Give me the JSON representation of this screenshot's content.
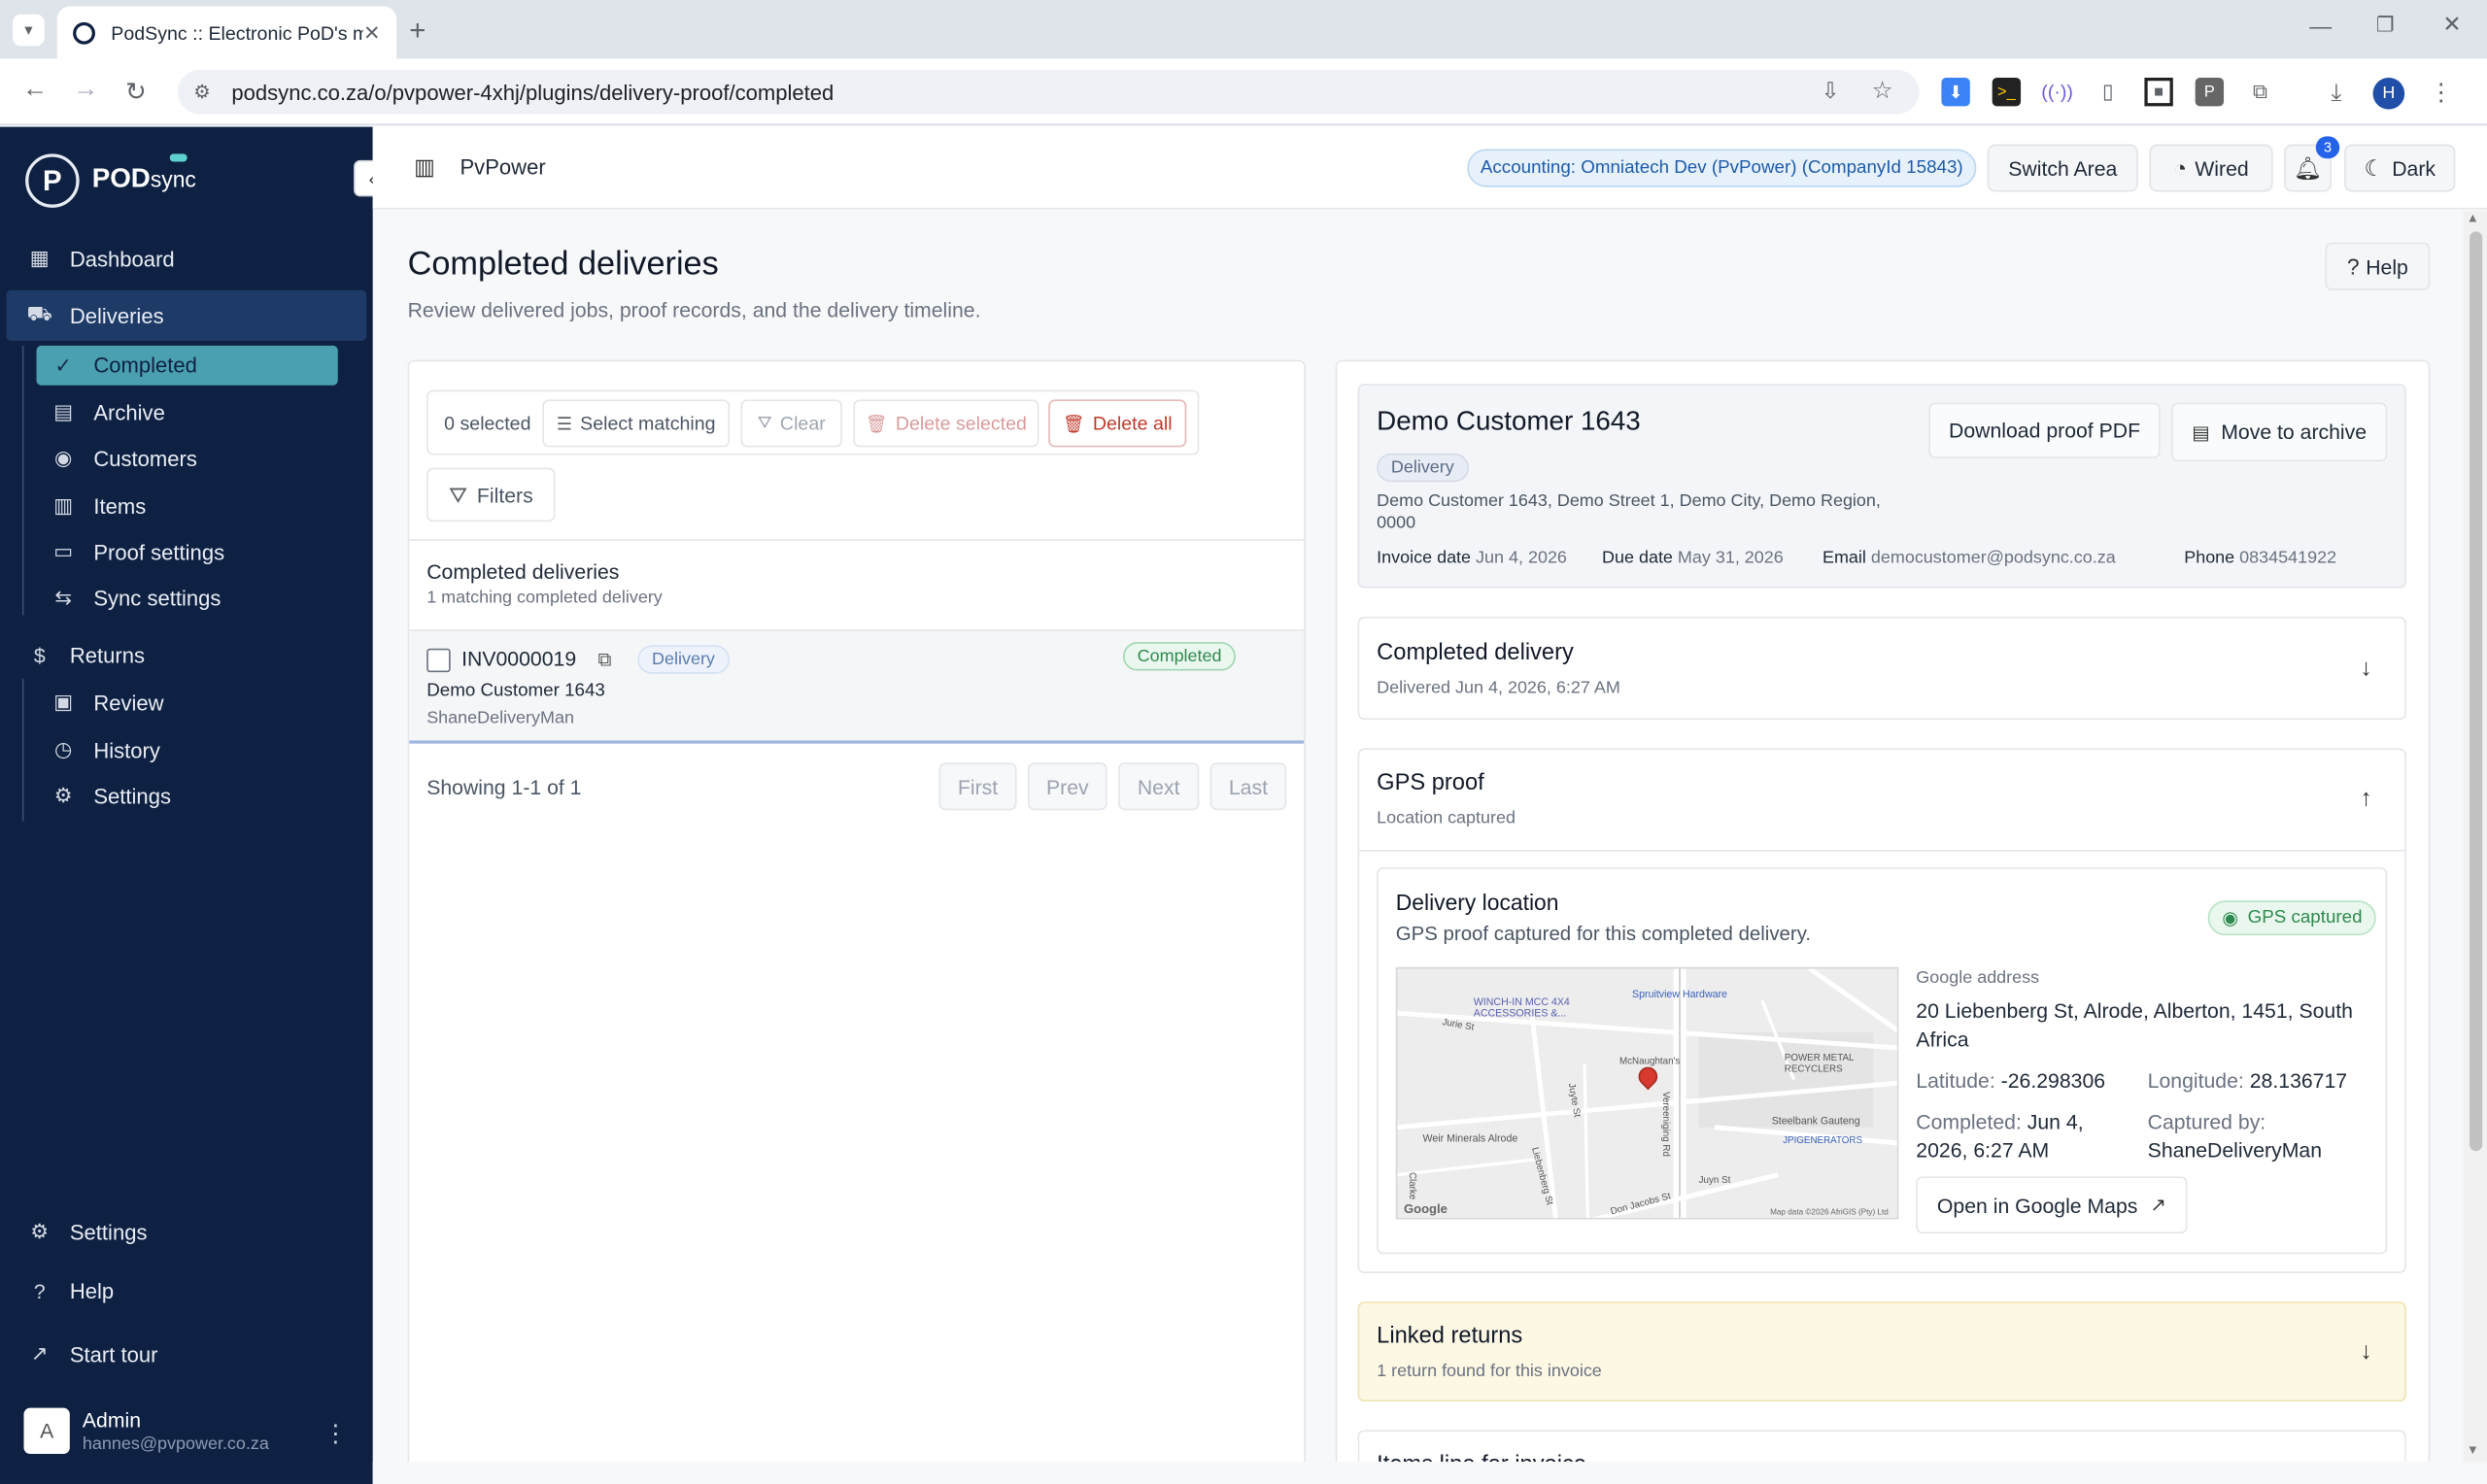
{
  "browser": {
    "tab_title": "PodSync :: Electronic PoD's made",
    "url": "podsync.co.za/o/pvpower-4xhj/plugins/delivery-proof/completed",
    "profile_initial": "H"
  },
  "sidebar": {
    "brand": "POD",
    "brand_suffix": "sync",
    "dashboard": "Dashboard",
    "deliveries": "Deliveries",
    "deliveries_items": [
      "Completed",
      "Archive",
      "Customers",
      "Items",
      "Proof settings",
      "Sync settings"
    ],
    "returns": "Returns",
    "returns_items": [
      "Review",
      "History",
      "Settings"
    ],
    "settings": "Settings",
    "help": "Help",
    "start_tour": "Start tour",
    "user": {
      "initial": "A",
      "name": "Admin",
      "email": "hannes@pvpower.co.za"
    }
  },
  "header": {
    "org": "PvPower",
    "accounting": "Accounting: Omniatech Dev (PvPower) (CompanyId 15843)",
    "switch_area": "Switch Area",
    "wired": "Wired",
    "notifications": "3",
    "dark": "Dark"
  },
  "page": {
    "title": "Completed deliveries",
    "subtitle": "Review delivered jobs, proof records, and the delivery timeline.",
    "help": "Help"
  },
  "list": {
    "selected": "0 selected",
    "select_matching": "Select matching",
    "clear": "Clear",
    "delete_selected": "Delete selected",
    "delete_all": "Delete all",
    "filters": "Filters",
    "heading": "Completed deliveries",
    "count": "1 matching completed delivery",
    "rows": [
      {
        "invoice": "INV0000019",
        "type": "Delivery",
        "status": "Completed",
        "customer": "Demo Customer 1643",
        "driver": "ShaneDeliveryMan"
      }
    ],
    "showing": "Showing 1-1 of 1",
    "pager": [
      "First",
      "Prev",
      "Next",
      "Last"
    ]
  },
  "detail": {
    "customer": "Demo Customer 1643",
    "type": "Delivery",
    "address": "Demo Customer 1643, Demo Street 1, Demo City, Demo Region, 0000",
    "invoice_date_label": "Invoice date",
    "invoice_date": "Jun 4, 2026",
    "due_date_label": "Due date",
    "due_date": "May 31, 2026",
    "email_label": "Email",
    "email": "democustomer@podsync.co.za",
    "phone_label": "Phone",
    "phone": "0834541922",
    "download_pdf": "Download proof PDF",
    "move_archive": "Move to archive",
    "completed_title": "Completed delivery",
    "completed_sub": "Delivered Jun 4, 2026, 6:27 AM",
    "gps_title": "GPS proof",
    "gps_sub": "Location captured",
    "location_title": "Delivery location",
    "location_sub": "GPS proof captured for this completed delivery.",
    "gps_badge": "GPS captured",
    "google_address_label": "Google address",
    "google_address": "20 Liebenberg St, Alrode, Alberton, 1451, South Africa",
    "latitude_label": "Latitude:",
    "latitude": "-26.298306",
    "longitude_label": "Longitude:",
    "longitude": "28.136717",
    "completed_label": "Completed:",
    "completed_value": "Jun 4, 2026, 6:27 AM",
    "captured_label": "Captured by:",
    "captured_value": "ShaneDeliveryMan",
    "open_maps": "Open in Google Maps",
    "linked_title": "Linked returns",
    "linked_sub": "1 return found for this invoice",
    "next_section_partial": "Items line for invoice"
  },
  "map": {
    "labels": [
      "WINCH-IN MCC 4X4 ACCESSORIES &...",
      "Spruitview Hardware",
      "Jurie St",
      "McNaughtan's",
      "POWER METAL RECYCLERS",
      "Juyte St",
      "Steelbank Gauteng",
      "JPIGENERATORS",
      "Weir Minerals Alrode",
      "Liebenberg St",
      "Vereeniging Rd",
      "Juyn St",
      "Don Jacobs St",
      "Clarke",
      "Google",
      "Map data ©2026 AfriGIS (Pty) Ltd"
    ]
  },
  "colors": {
    "sidebar": "#0f2142",
    "accent": "#4aa0b0",
    "danger": "#d04848",
    "success": "#2e9a5a"
  }
}
